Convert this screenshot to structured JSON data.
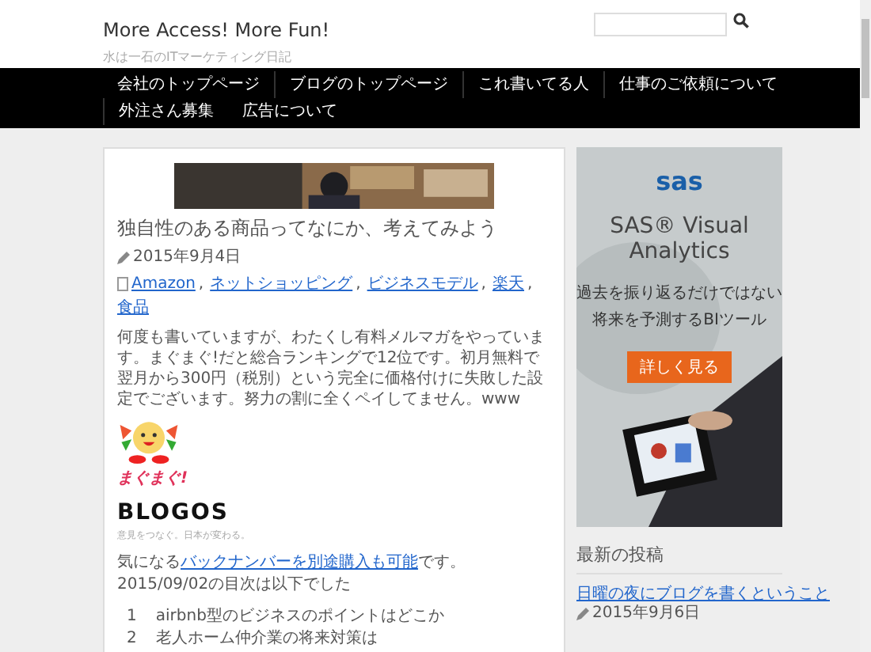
{
  "header": {
    "site_title": "More Access! More Fun!",
    "tagline": "水は一石のITマーケティング日記"
  },
  "nav": [
    "会社のトップページ",
    "ブログのトップページ",
    "これ書いてる人",
    "仕事のご依頼について",
    "外注さん募集",
    "広告について"
  ],
  "post": {
    "banner": {
      "kind": "picture"
    },
    "title": "独自性のある商品ってなにか、考えてみよう",
    "date": "2015年9月4日",
    "categories": [
      "Amazon",
      "ネットショッピング",
      "ビジネスモデル",
      "楽天",
      "食品"
    ],
    "category_separator": ",",
    "paragraph": "何度も書いていますが、わたくし有料メルマガをやっています。まぐまぐ!だと総合ランキングで12位です。初月無料で翌月から300円（税別）という完全に価格付けに失敗した設定でございます。努力の割に全くペイしてません。www",
    "mascot_logo": "まぐまぐ!",
    "blogos_logo": "BLOGOS",
    "blogos_tagline": "意見をつなぐ。日本が変わる。",
    "backnumber": {
      "before": "気になる",
      "link": "バックナンバーを別途購入も可能",
      "after": "です。"
    },
    "toc_intro": "2015/09/02の目次は以下でした",
    "toc": [
      {
        "number": "1",
        "text": "airbnb型のビジネスのポイントはどこか"
      },
      {
        "number": "2",
        "text": "老人ホーム仲介業の将来対策は"
      }
    ]
  },
  "sidebar": {
    "ad": {
      "brand": "sas",
      "headline": "SAS® Visual Analytics",
      "copy_1": "過去を振り返るだけではない",
      "copy_2": "将来を予測するBIツール",
      "button": "詳しく見る"
    },
    "recent_title": "最新の投稿",
    "recent": [
      {
        "title": "日曜の夜にブログを書くということ",
        "date": "2015年9月6日"
      }
    ]
  }
}
